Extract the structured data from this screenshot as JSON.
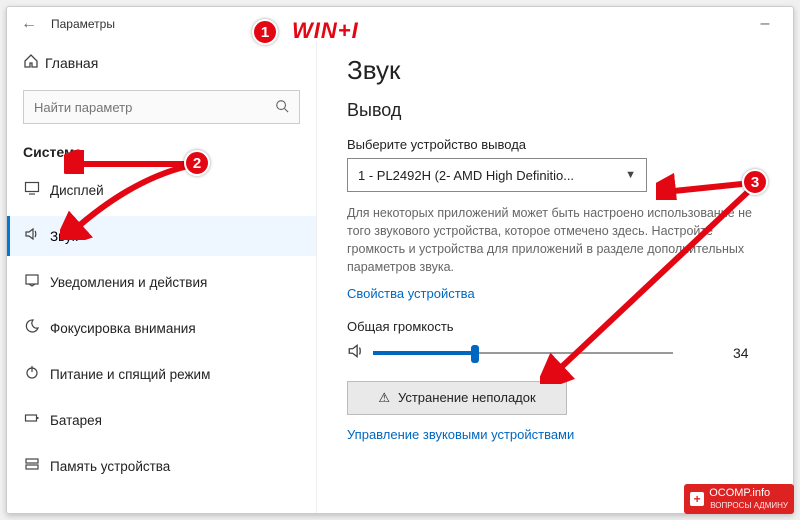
{
  "annotations": {
    "hotkey": "WIN+I",
    "badge1": "1",
    "badge2": "2",
    "badge3": "3"
  },
  "titlebar": {
    "title": "Параметры"
  },
  "sidebar": {
    "home": "Главная",
    "search_placeholder": "Найти параметр",
    "section": "Система",
    "items": [
      {
        "icon": "display",
        "label": "Дисплей"
      },
      {
        "icon": "sound",
        "label": "Звук"
      },
      {
        "icon": "notif",
        "label": "Уведомления и действия"
      },
      {
        "icon": "focus",
        "label": "Фокусировка внимания"
      },
      {
        "icon": "power",
        "label": "Питание и спящий режим"
      },
      {
        "icon": "battery",
        "label": "Батарея"
      },
      {
        "icon": "storage",
        "label": "Память устройства"
      }
    ],
    "active_index": 1
  },
  "content": {
    "heading": "Звук",
    "output_heading": "Вывод",
    "select_label": "Выберите устройство вывода",
    "selected_device": "1 - PL2492H (2- AMD High Definitio...",
    "description": "Для некоторых приложений может быть настроено использование не того звукового устройства, которое отмечено здесь. Настройте громкость и устройства для приложений в разделе дополнительных параметров звука.",
    "device_props_link": "Свойства устройства",
    "volume_label": "Общая громкость",
    "volume_value": "34",
    "troubleshoot": "Устранение неполадок",
    "manage_link": "Управление звуковыми устройствами"
  },
  "watermark": {
    "brand": "OCOMP",
    "tld": ".info",
    "sub": "ВОПРОСЫ АДМИНУ"
  }
}
